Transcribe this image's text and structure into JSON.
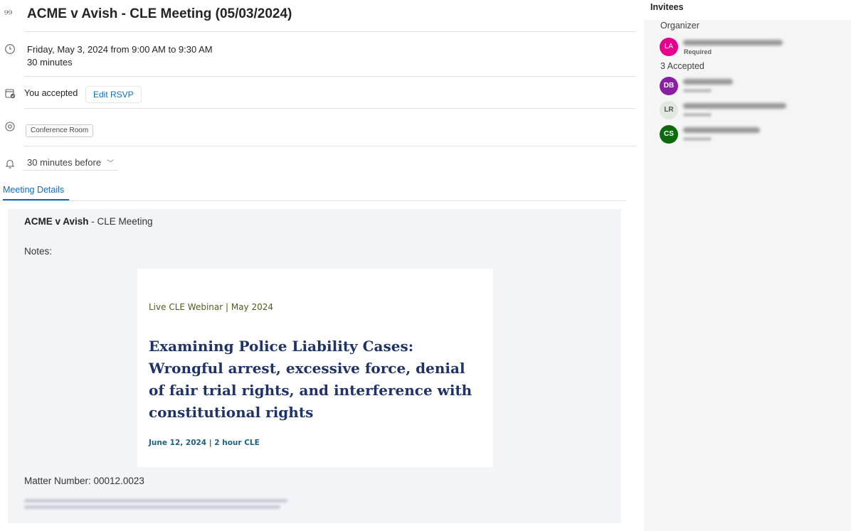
{
  "event": {
    "title": "ACME v Avish - CLE Meeting (05/03/2024)",
    "datetime": "Friday, May 3, 2024 from 9:00 AM to 9:30 AM",
    "duration": "30 minutes",
    "rsvp_status": "You accepted",
    "edit_rsvp_label": "Edit RSVP",
    "location": "Conference Room",
    "reminder": "30 minutes before"
  },
  "tabs": [
    {
      "label": "Meeting Details",
      "active": true
    }
  ],
  "details": {
    "heading_bold": "ACME v Avish",
    "heading_rest": " - CLE Meeting",
    "notes_label": "Notes:",
    "card": {
      "kicker": "Live CLE Webinar | May 2024",
      "title": "Examining Police Liability Cases: Wrongful arrest, excessive force, denial of fair trial rights, and interference with constitutional rights",
      "date_line": "June 12, 2024 | 2 hour CLE"
    },
    "matter_number": "Matter Number: 00012.0023"
  },
  "invitees": {
    "title": "Invitees",
    "organizer_label": "Organizer",
    "organizer": {
      "initials": "LA",
      "color": "#e3008c",
      "role": "Required"
    },
    "accepted_label": "3 Accepted",
    "accepted": [
      {
        "initials": "DB",
        "color": "#8a1fa3",
        "text_color": "#ffffff"
      },
      {
        "initials": "LR",
        "color": "#e1e8df",
        "text_color": "#555555"
      },
      {
        "initials": "CS",
        "color": "#0b6a0b",
        "text_color": "#ffffff"
      }
    ]
  },
  "colors": {
    "accent": "#0f6cbd",
    "card_title": "#1f3368",
    "details_bg": "#f2f4f7"
  }
}
